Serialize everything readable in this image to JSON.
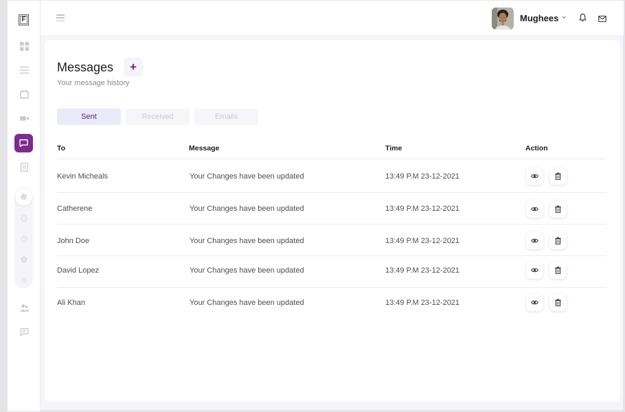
{
  "logo": "F",
  "user": {
    "name": "Mughees"
  },
  "page": {
    "title": "Messages",
    "subtitle": "Your message history",
    "add_label": "+"
  },
  "tabs": [
    {
      "label": "Sent",
      "active": true
    },
    {
      "label": "Received",
      "active": false
    },
    {
      "label": "Emails",
      "active": false
    }
  ],
  "table": {
    "headers": [
      "To",
      "Message",
      "Time",
      "Action"
    ],
    "rows": [
      {
        "to": "Kevin Micheals",
        "message": "Your Changes have been updated",
        "time": "13:49 P.M 23-12-2021"
      },
      {
        "to": "Catherene",
        "message": "Your Changes have been updated",
        "time": "13:49 P.M 23-12-2021"
      },
      {
        "to": "John Doe",
        "message": "Your Changes have been updated",
        "time": "13:49 P.M 23-12-2021"
      },
      {
        "to": "David Lopez",
        "message": "Your Changes have been updated",
        "time": "13:49 P.M 23-12-2021"
      },
      {
        "to": "Ali Khan",
        "message": "Your Changes have been updated",
        "time": "13:49 P.M 23-12-2021"
      }
    ]
  },
  "icons": {
    "sidebar": [
      "dashboard-icon",
      "list-icon",
      "calendar-icon",
      "video-icon",
      "chat-icon",
      "document-icon",
      "gear-icon",
      "clock-icon",
      "clock-icon",
      "globe-icon",
      "sun-icon",
      "users-icon",
      "feedback-icon"
    ],
    "header": [
      "menu-icon",
      "bell-icon",
      "mail-icon"
    ],
    "actions": [
      "eye-icon",
      "trash-icon"
    ]
  },
  "colors": {
    "accent": "#7b2c8f",
    "accent_text": "#5f1c73",
    "tab_active_bg": "#e9ebf8"
  }
}
